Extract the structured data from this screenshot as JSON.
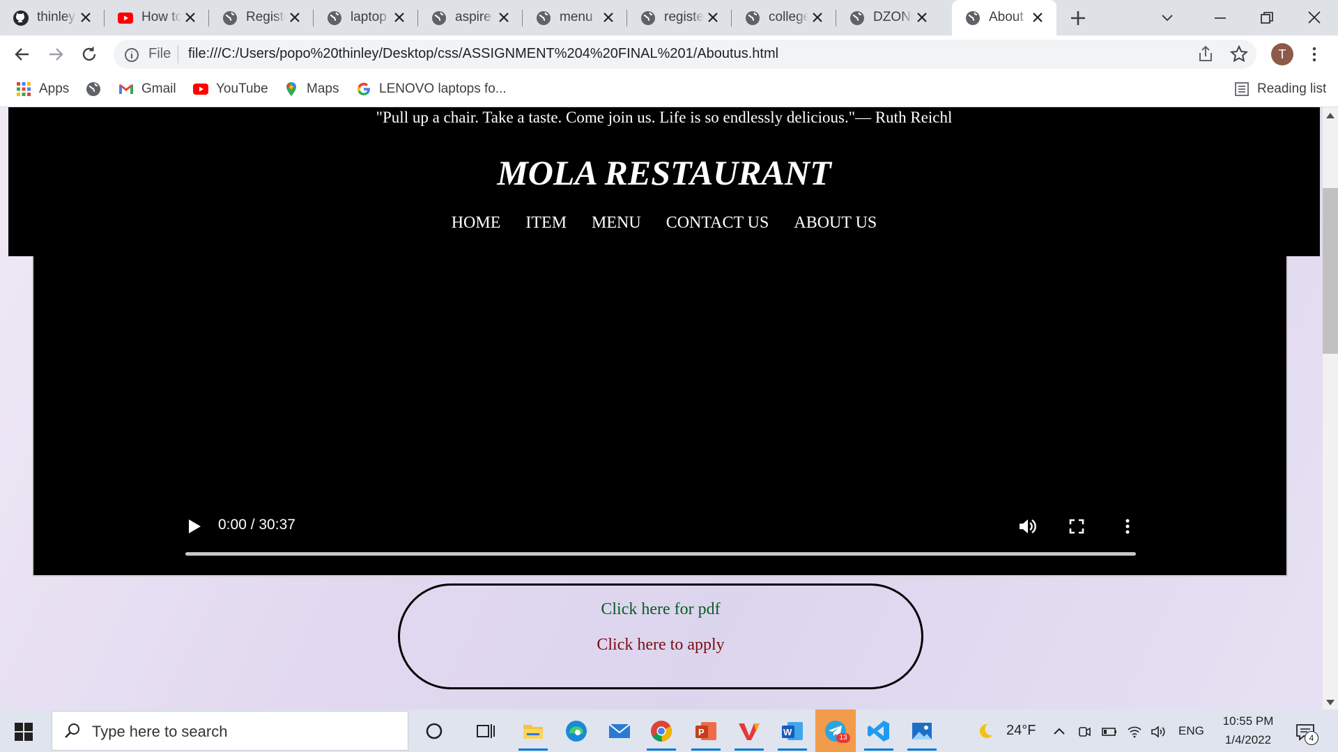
{
  "browser": {
    "tabs": [
      {
        "title": "thinley",
        "icon": "github-icon",
        "active": false
      },
      {
        "title": "How to",
        "icon": "youtube-icon",
        "active": false
      },
      {
        "title": "Registe",
        "icon": "globe-icon",
        "active": false
      },
      {
        "title": "laptop",
        "icon": "globe-icon",
        "active": false
      },
      {
        "title": "aspire",
        "icon": "globe-icon",
        "active": false
      },
      {
        "title": "menu",
        "icon": "globe-icon",
        "active": false
      },
      {
        "title": "registe",
        "icon": "globe-icon",
        "active": false
      },
      {
        "title": "college",
        "icon": "globe-icon",
        "active": false
      },
      {
        "title": "DZONG",
        "icon": "globe-icon",
        "active": false
      },
      {
        "title": "About",
        "icon": "globe-icon",
        "active": true
      }
    ],
    "address": {
      "scheme_label": "File",
      "url": "file:///C:/Users/popo%20thinley/Desktop/css/ASSIGNMENT%204%20FINAL%201/Aboutus.html"
    },
    "profile_initial": "T",
    "bookmarks": [
      {
        "label": "Apps",
        "icon": "apps-grid-icon"
      },
      {
        "label": "",
        "icon": "globe-icon"
      },
      {
        "label": "Gmail",
        "icon": "gmail-icon"
      },
      {
        "label": "YouTube",
        "icon": "youtube-icon"
      },
      {
        "label": "Maps",
        "icon": "maps-pin-icon"
      },
      {
        "label": "LENOVO laptops fo...",
        "icon": "google-icon"
      }
    ],
    "reading_list_label": "Reading list"
  },
  "page": {
    "quote": "\"Pull up a chair. Take a taste. Come join us. Life is so endlessly delicious.\"— Ruth Reichl",
    "site_title": "MOLA RESTAURANT",
    "nav": [
      "HOME",
      "ITEM",
      "MENU",
      "CONTACT US",
      "ABOUT US"
    ],
    "video": {
      "time": "0:00 / 30:37",
      "progress": 0
    },
    "pdf_link": "Click here for pdf",
    "apply_link": "Click here to apply",
    "colors": {
      "header_bg": "#000000",
      "pdf_link": "#0b5a23",
      "apply_link": "#7a0d12"
    }
  },
  "taskbar": {
    "search_placeholder": "Type here to search",
    "apps": [
      "cortana-icon",
      "task-view-icon",
      "file-explorer-icon",
      "edge-icon",
      "mail-icon",
      "chrome-icon",
      "powerpoint-icon",
      "vector-app-icon",
      "word-icon",
      "telegram-icon",
      "vscode-icon",
      "photos-icon"
    ],
    "telegram_badge": "13",
    "temperature": "24°F",
    "language": "ENG",
    "time": "10:55 PM",
    "date": "1/4/2022",
    "notification_count": "4"
  }
}
